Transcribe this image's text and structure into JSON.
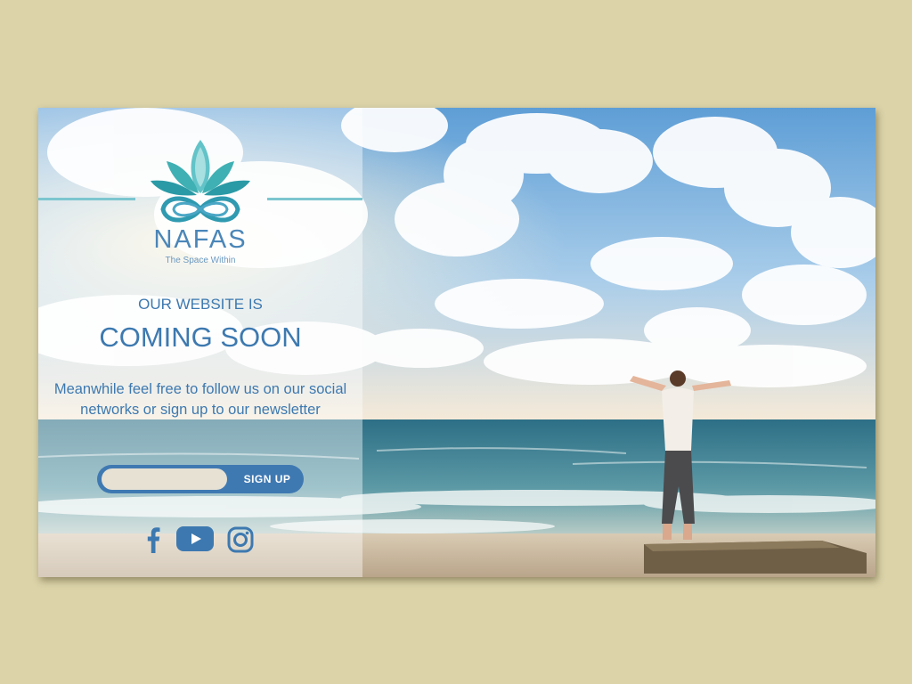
{
  "brand": {
    "name": "NAFAS",
    "tagline": "The Space Within"
  },
  "announcement": {
    "pre_heading": "OUR WEBSITE IS",
    "heading": "COMING SOON",
    "body": "Meanwhile feel free to follow us on our social networks or sign up to our newsletter"
  },
  "newsletter": {
    "email_value": "",
    "button_label": "SIGN UP"
  },
  "social": [
    {
      "icon": "facebook-icon"
    },
    {
      "icon": "youtube-icon"
    },
    {
      "icon": "instagram-icon"
    }
  ],
  "colors": {
    "page_background": "#dcd3a9",
    "accent_blue": "#3d79b0",
    "logo_teal": "#3fb0b3",
    "divider_teal": "#7cc6cf"
  }
}
